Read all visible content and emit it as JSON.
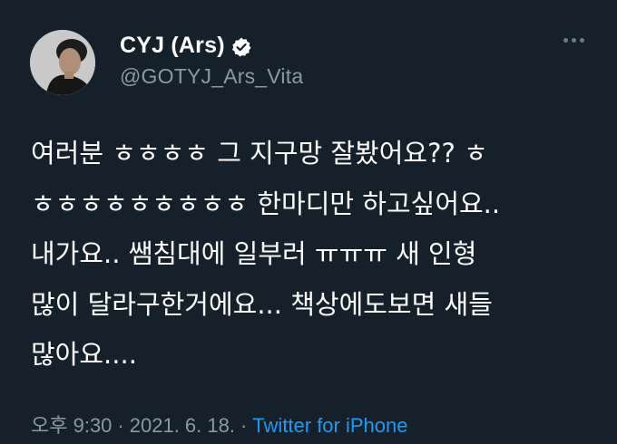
{
  "tweet": {
    "author": {
      "display_name": "CYJ (Ars)",
      "handle": "@GOTYJ_Ars_Vita",
      "verified": true,
      "verified_icon": "verified-badge-icon"
    },
    "text_lines": [
      "여러분 ㅎㅎㅎㅎ 그 지구망 잘봤어요?? ㅎ",
      "ㅎㅎㅎㅎㅎㅎㅎㅎㅎ 한마디만 하고싶어요..",
      "내가요.. 쌤침대에 일부러 ㅠㅠㅠ 새 인형",
      "많이 달라구한거에요... 책상에도보면 새들",
      "많아요...."
    ],
    "time": "오후 9:30",
    "date": "2021. 6. 18.",
    "separator": "·",
    "source": "Twitter for iPhone",
    "more_icon": "more-options-icon"
  },
  "colors": {
    "background": "#15202b",
    "text": "#ffffff",
    "secondary": "#8b98a5",
    "accent": "#1d9bf0"
  }
}
